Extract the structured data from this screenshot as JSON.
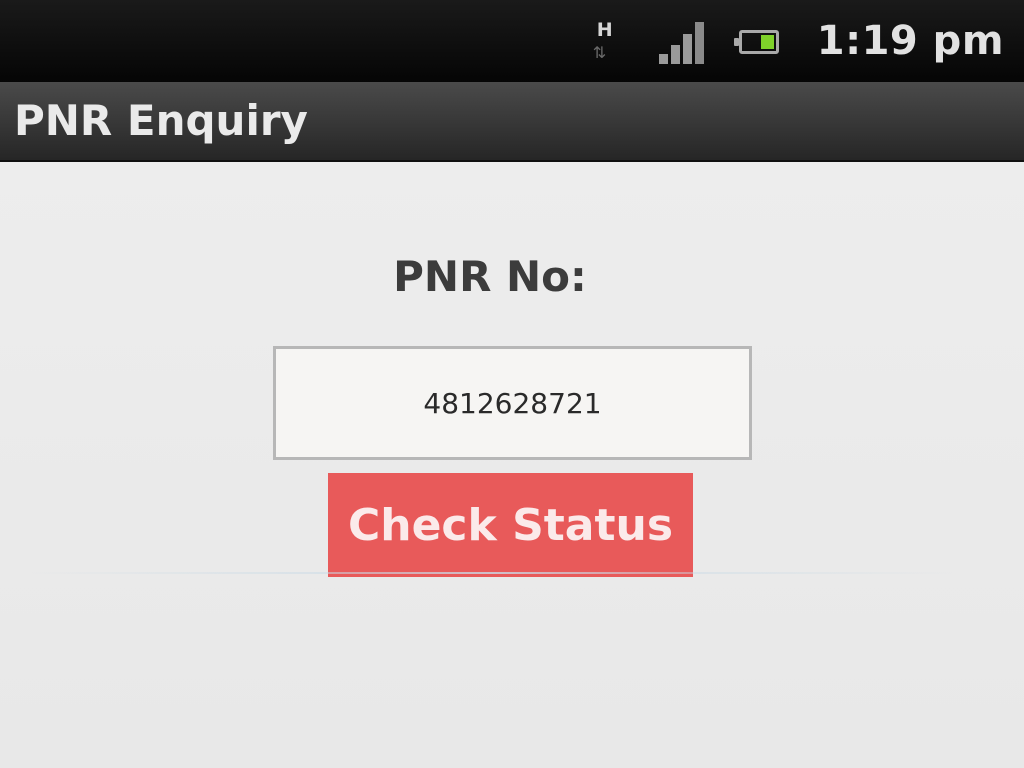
{
  "status_bar": {
    "network_type": "H",
    "network_arrows": "⇅",
    "time": "1:19 pm",
    "icons": [
      "network-h-icon",
      "signal-strength-icon",
      "battery-icon"
    ],
    "battery_color": "#7fd12a"
  },
  "title_bar": {
    "title": "PNR Enquiry"
  },
  "form": {
    "label": "PNR No:",
    "pnr_value": "4812628721",
    "button_label": "Check Status",
    "button_color": "#e85a5a"
  }
}
